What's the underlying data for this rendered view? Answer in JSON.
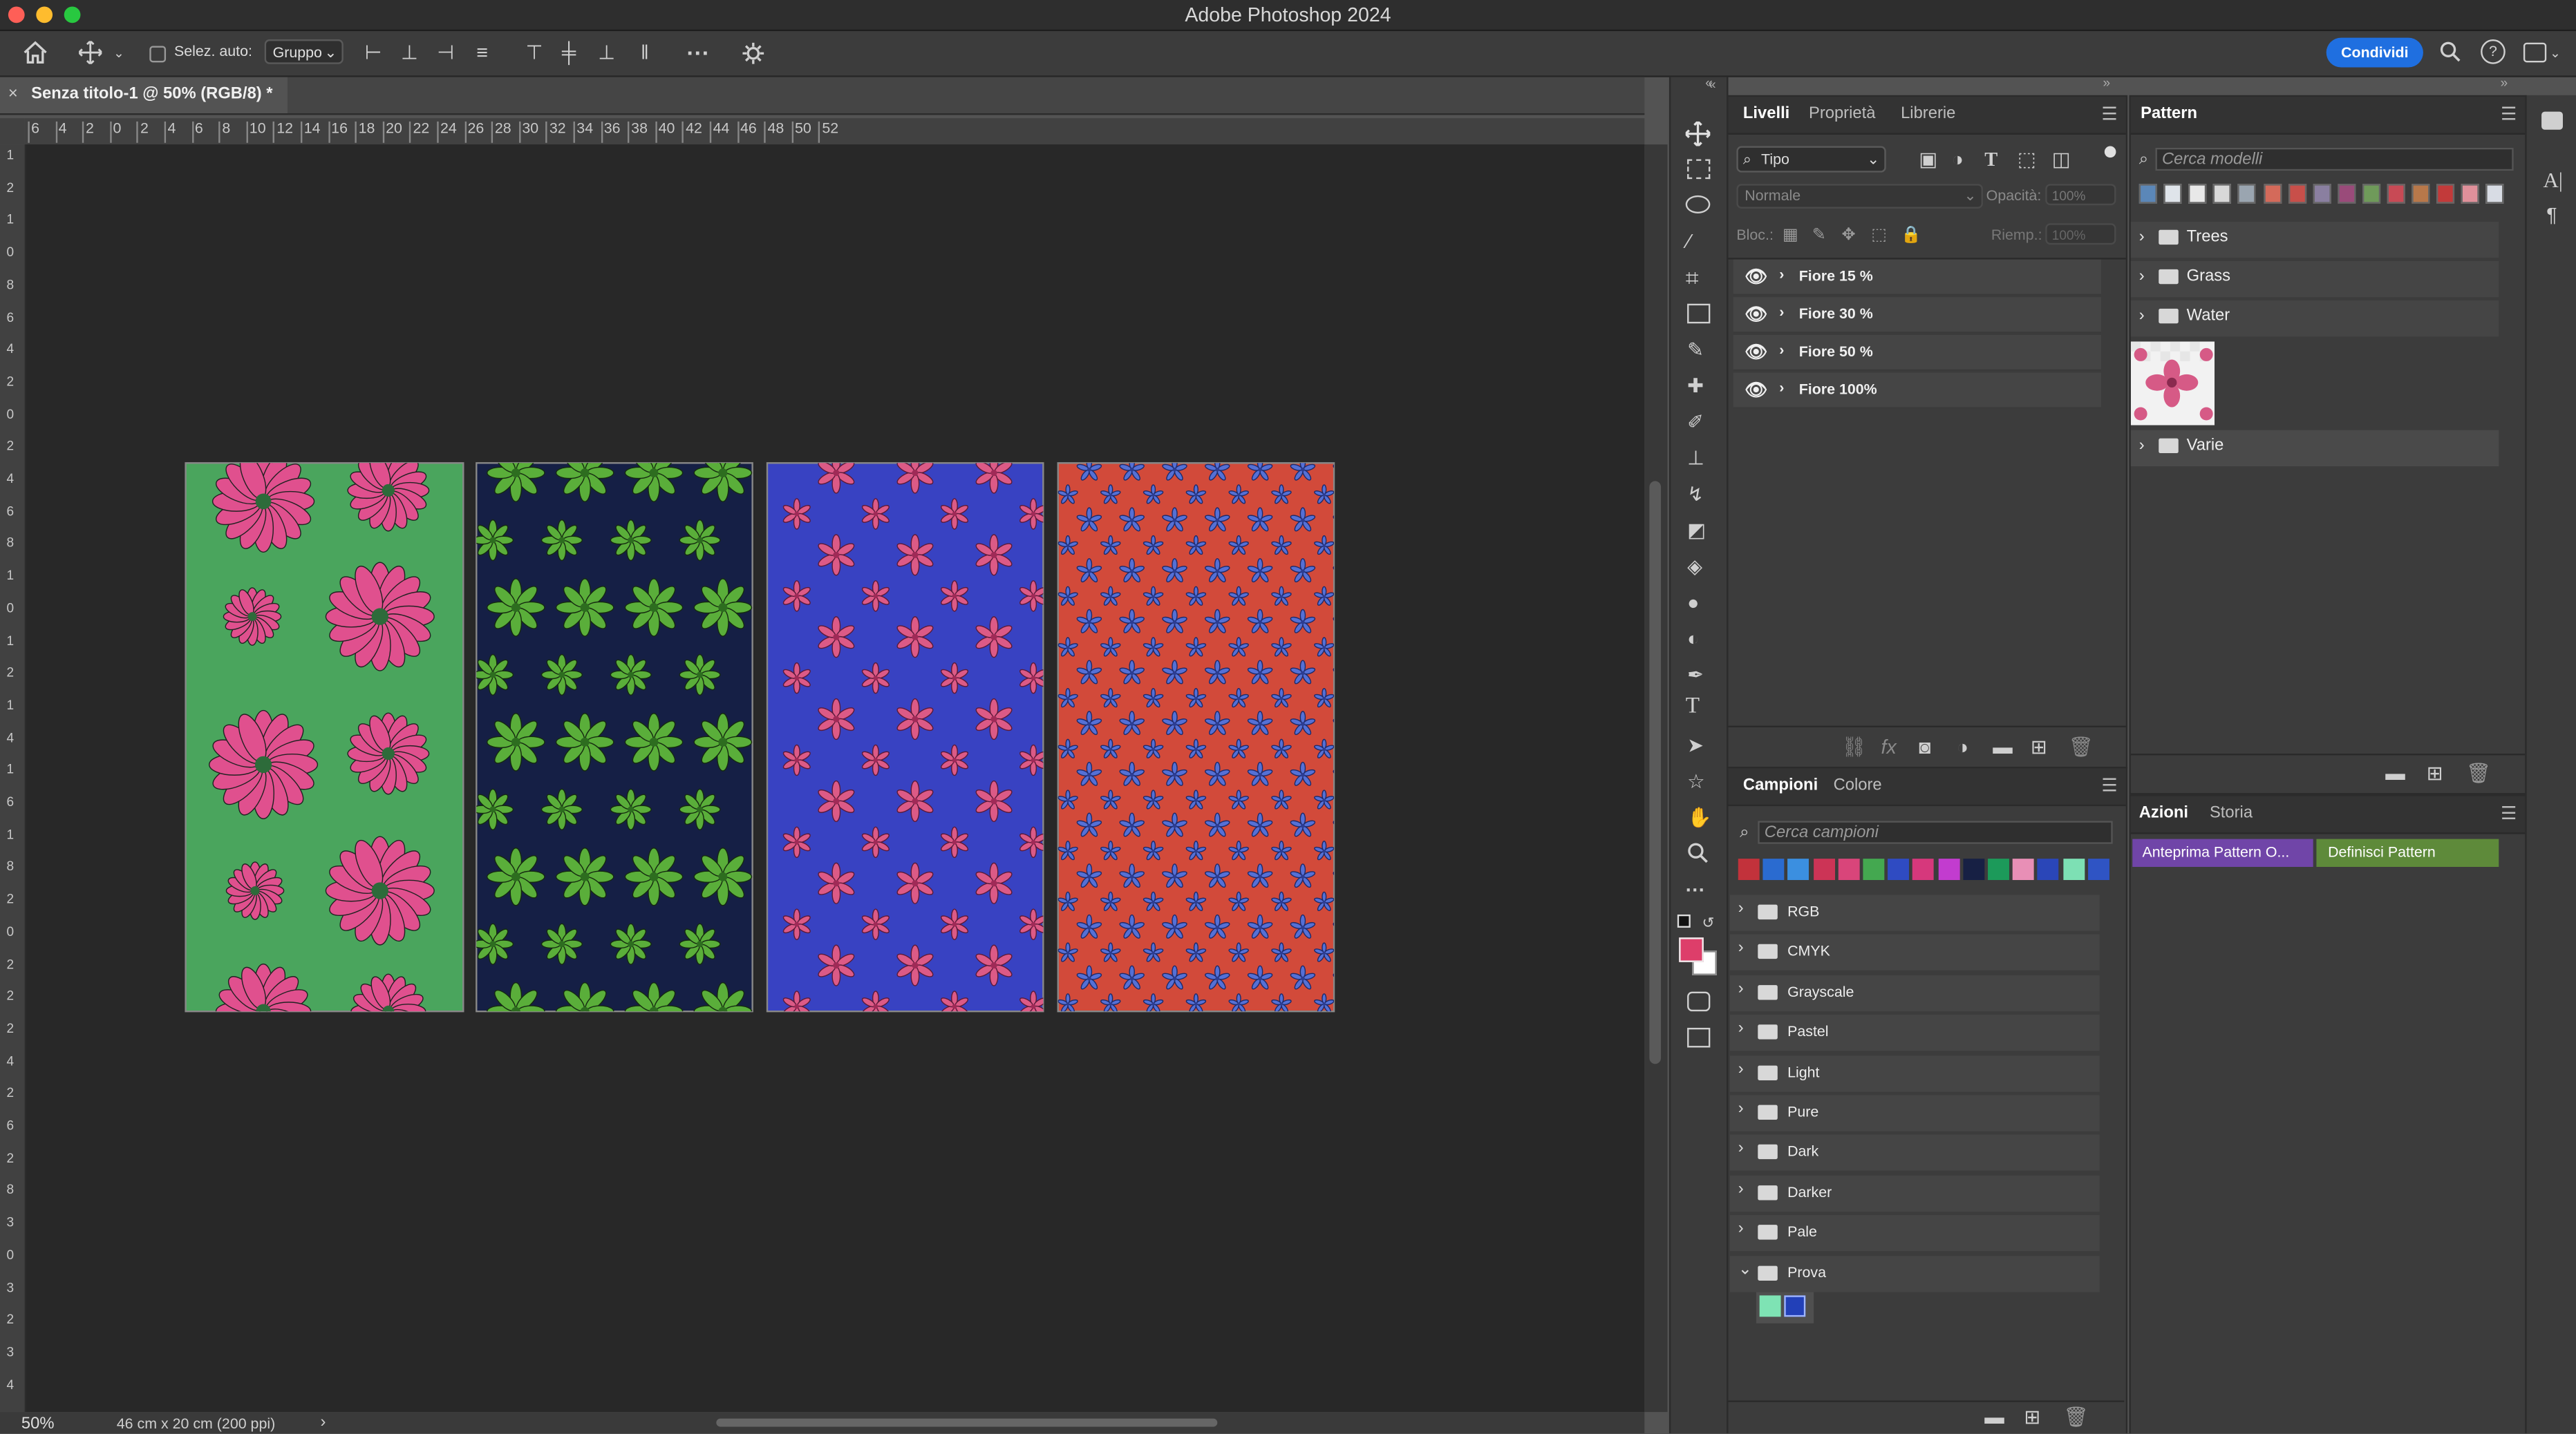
{
  "app": {
    "title": "Adobe Photoshop 2024",
    "share_label": "Condividi"
  },
  "options": {
    "autoselect_label": "Selez. auto:",
    "autoselect_mode": "Gruppo"
  },
  "document": {
    "tab_title": "Senza titolo-1 @ 50% (RGB/8) *",
    "zoom": "50%",
    "doc_info": "46 cm x 20 cm (200 ppi)",
    "ruler_h_ticks": [
      "6",
      "4",
      "2",
      "0",
      "2",
      "4",
      "6",
      "8",
      "10",
      "12",
      "14",
      "16",
      "18",
      "20",
      "22",
      "24",
      "26",
      "28",
      "30",
      "32",
      "34",
      "36",
      "38",
      "40",
      "42",
      "44",
      "46",
      "48",
      "50",
      "52"
    ],
    "ruler_v_ticks": [
      "1",
      "2",
      "1",
      "0",
      "8",
      "6",
      "4",
      "2",
      "0",
      "2",
      "4",
      "6",
      "8",
      "1",
      "0",
      "1",
      "2",
      "1",
      "4",
      "1",
      "6",
      "1",
      "8",
      "2",
      "0",
      "2",
      "2",
      "2",
      "4",
      "2",
      "6",
      "2",
      "8",
      "3",
      "0",
      "3",
      "2",
      "3",
      "4"
    ]
  },
  "artboards": [
    {
      "name": "green",
      "bg": "#4aa55d",
      "flower": "#e0508e",
      "center": "#2d6b3a"
    },
    {
      "name": "navy",
      "bg": "#151f45",
      "flower": "#5aae3a",
      "center": "#2d6d1f"
    },
    {
      "name": "blue",
      "bg": "#3842c2",
      "flower": "#dc5a86",
      "center": "#a02a57"
    },
    {
      "name": "red",
      "bg": "#d24a3a",
      "flower": "#5570d6",
      "center": "#2c3d93"
    }
  ],
  "layers_panel": {
    "tabs": [
      "Livelli",
      "Proprietà",
      "Librerie"
    ],
    "filter": "Tipo",
    "blend_mode": "Normale",
    "opacity_label": "Opacità:",
    "opacity_value": "100%",
    "lock_label": "Bloc.:",
    "fill_label": "Riemp.:",
    "fill_value": "100%",
    "layers": [
      "Fiore 15 %",
      "Fiore 30 %",
      "Fiore 50 %",
      "Fiore 100%"
    ]
  },
  "swatches_panel": {
    "tabs": [
      "Campioni",
      "Colore"
    ],
    "search_placeholder": "Cerca campioni",
    "colors": [
      "#c2323b",
      "#2a6bd0",
      "#3b8fe0",
      "#cc3456",
      "#d9457a",
      "#44a850",
      "#2f4bc2",
      "#d6387c",
      "#c23ccf",
      "#172044",
      "#1c9a5a",
      "#e88fb6",
      "#2a46b8",
      "#7de0b4",
      "#2f54c4"
    ],
    "groups": [
      "RGB",
      "CMYK",
      "Grayscale",
      "Pastel",
      "Light",
      "Pure",
      "Dark",
      "Darker",
      "Pale",
      "Prova"
    ],
    "prova_colors": [
      "#7ee3b4",
      "#2240b8"
    ]
  },
  "patterns_panel": {
    "title": "Pattern",
    "search_placeholder": "Cerca modelli",
    "groups": [
      "Trees",
      "Grass",
      "Water",
      "Varie"
    ],
    "thumb_colors": [
      "#5b87b8",
      "#dfe4ea",
      "#e8e8e8",
      "#d8d8d8",
      "#9aa5b0",
      "#d46a5a",
      "#c84f4a",
      "#8a7fa0",
      "#9a4b7a",
      "#6f9a5a",
      "#c84a55",
      "#b8784a",
      "#c23a3a",
      "#e0909a",
      "#d8dce4"
    ]
  },
  "actions_panel": {
    "tabs": [
      "Azioni",
      "Storia"
    ],
    "actions": [
      {
        "label": "Anteprima Pattern O...",
        "color": "#7045a8"
      },
      {
        "label": "Definisci Pattern",
        "color": "#5e8a3a"
      }
    ]
  }
}
